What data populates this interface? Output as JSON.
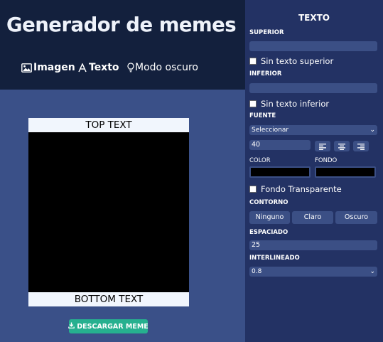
{
  "header": {
    "title": "Generador de memes",
    "nav": {
      "image_label": "Imagen",
      "text_label": "Texto",
      "dark_label": "Modo oscuro"
    }
  },
  "meme": {
    "top_text": "TOP TEXT",
    "bottom_text": "BOTTOM TEXT"
  },
  "actions": {
    "download_label": "DESCARGAR MEME"
  },
  "panel": {
    "title": "TEXTO",
    "superior_label": "SUPERIOR",
    "superior_value": "",
    "no_top_label": "Sin texto superior",
    "inferior_label": "INFERIOR",
    "inferior_value": "",
    "no_bottom_label": "Sin texto inferior",
    "font_label": "FUENTE",
    "font_selected": "Seleccionar",
    "font_size": "40",
    "color_label": "COLOR",
    "background_label": "FONDO",
    "text_color": "#000000",
    "background_color": "#000000",
    "transparent_label": "Fondo Transparente",
    "outline_label": "CONTORNO",
    "outline_options": [
      "Ninguno",
      "Claro",
      "Oscuro"
    ],
    "spacing_label": "ESPACIADO",
    "spacing_value": "25",
    "line_height_label": "INTERLINEADO",
    "line_height_selected": "0.8"
  },
  "colors": {
    "header_bg": "#13203d",
    "main_bg": "#3a5088",
    "panel_bg": "#233264",
    "field_bg": "#3b4f85",
    "download_bg": "#26b08f"
  }
}
